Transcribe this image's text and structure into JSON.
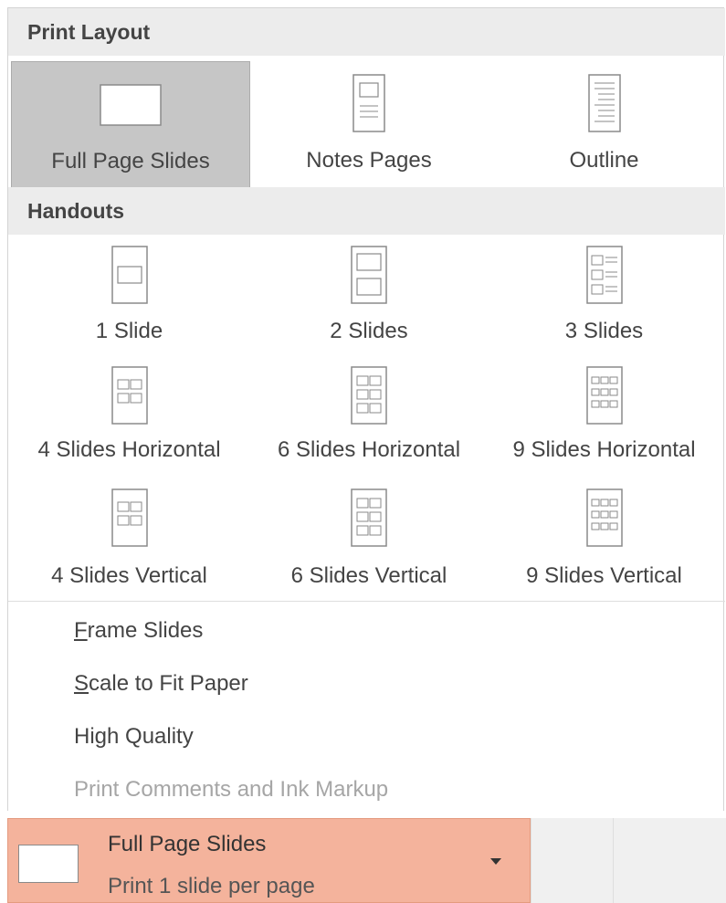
{
  "print_layout": {
    "header": "Print Layout",
    "items": [
      {
        "label": "Full Page Slides",
        "icon": "full-page-slide-icon",
        "selected": true
      },
      {
        "label": "Notes Pages",
        "icon": "notes-pages-icon",
        "selected": false
      },
      {
        "label": "Outline",
        "icon": "outline-icon",
        "selected": false
      }
    ]
  },
  "handouts": {
    "header": "Handouts",
    "items": [
      {
        "label": "1 Slide",
        "icon": "handout-1-slide-icon"
      },
      {
        "label": "2 Slides",
        "icon": "handout-2-slides-icon"
      },
      {
        "label": "3 Slides",
        "icon": "handout-3-slides-icon"
      },
      {
        "label": "4 Slides Horizontal",
        "icon": "handout-4-horizontal-icon"
      },
      {
        "label": "6 Slides Horizontal",
        "icon": "handout-6-horizontal-icon"
      },
      {
        "label": "9 Slides Horizontal",
        "icon": "handout-9-horizontal-icon"
      },
      {
        "label": "4 Slides Vertical",
        "icon": "handout-4-vertical-icon"
      },
      {
        "label": "6 Slides Vertical",
        "icon": "handout-6-vertical-icon"
      },
      {
        "label": "9 Slides Vertical",
        "icon": "handout-9-vertical-icon"
      }
    ]
  },
  "options": {
    "frame_slides": {
      "accel": "F",
      "rest": "rame Slides"
    },
    "scale_to_fit": {
      "accel": "S",
      "rest": "cale to Fit Paper"
    },
    "high_quality": "High Quality",
    "print_comments": "Print Comments and Ink Markup"
  },
  "dropdown": {
    "title": "Full Page Slides",
    "subtitle": "Print 1 slide per page"
  },
  "colors": {
    "selected_tile": "#c6c6c6",
    "header_bg": "#ececec",
    "dropdown_bg": "#f4b39c"
  }
}
